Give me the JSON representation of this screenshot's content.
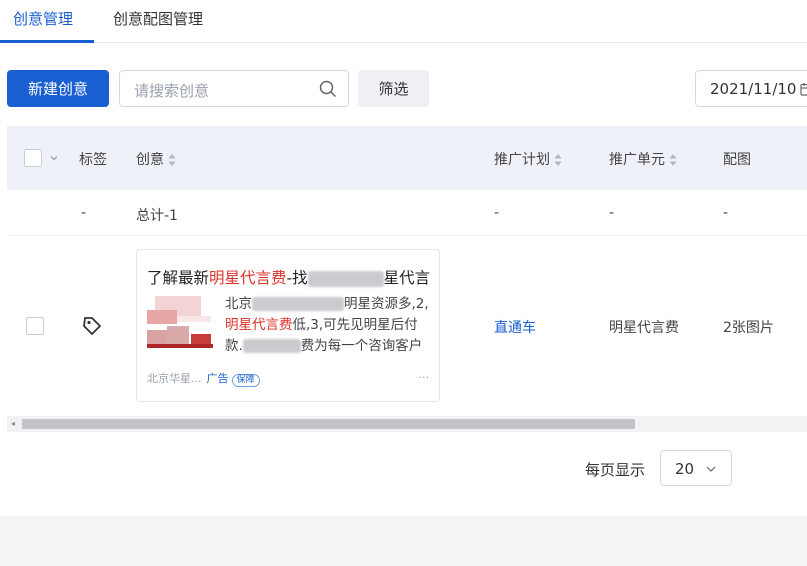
{
  "tabs": [
    {
      "label": "创意管理",
      "active": true
    },
    {
      "label": "创意配图管理",
      "active": false
    }
  ],
  "toolbar": {
    "new_button": "新建创意",
    "search_placeholder": "请搜索创意",
    "filter_button": "筛选",
    "date_value": "2021/11/10"
  },
  "table": {
    "headers": {
      "tag": "标签",
      "creative": "创意",
      "plan": "推广计划",
      "unit": "推广单元",
      "image": "配图"
    },
    "total_row": {
      "tag": "-",
      "creative": "总计-1",
      "plan": "-",
      "unit": "-",
      "image": "-"
    },
    "rows": [
      {
        "creative": {
          "title_prefix": "了解最新",
          "title_highlight": "明星代言费",
          "title_mid": "-找",
          "title_suffix": "星代言",
          "line1_prefix": "北京",
          "line1_suffix": "明星资源多,2,",
          "line2_highlight": "明星代言费",
          "line2_suffix": "低,3,可先见明星后付",
          "line3_prefix": "款.",
          "line3_suffix": "费为每一个咨询客户",
          "footer_source": "北京华星...",
          "footer_ad": "广告",
          "footer_badge": "保障",
          "footer_more": "..."
        },
        "plan": "直通车",
        "unit": "明星代言费",
        "image": "2张图片"
      }
    ]
  },
  "pagination": {
    "label": "每页显示",
    "page_size": "20"
  },
  "colors": {
    "accent": "#1a5fd1",
    "highlight": "#e0322b",
    "header_bg": "#eef1f7"
  }
}
